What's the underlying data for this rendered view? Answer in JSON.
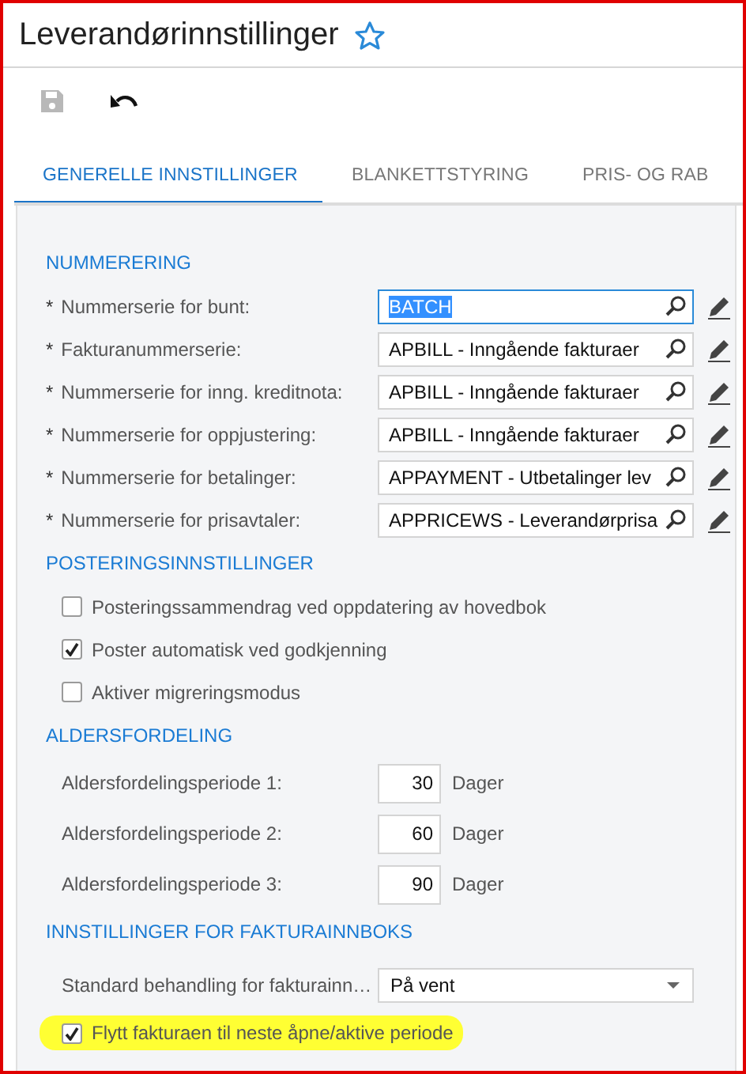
{
  "window": {
    "title": "Leverandørinnstillinger",
    "favorite": false
  },
  "toolbar": [
    {
      "kind": "save",
      "disabled": true
    },
    {
      "kind": "undo",
      "disabled": false
    }
  ],
  "tabs": [
    {
      "label": "GENERELLE INNSTILLINGER",
      "selected": true
    },
    {
      "label": "BLANKETTSTYRING",
      "selected": false
    },
    {
      "label": "PRIS- OG RAB",
      "selected": false
    }
  ],
  "sections": [
    {
      "title": "NUMMERERING",
      "rows": [
        {
          "kind": "lookup",
          "mark": "*",
          "label": "Nummerserie for bunt:",
          "value": "BATCH",
          "focused": true
        },
        {
          "kind": "lookup",
          "mark": "*",
          "label": "Fakturanummerserie:",
          "value": "APBILL - Inngående fakturaer",
          "focused": false
        },
        {
          "kind": "lookup",
          "mark": "*",
          "label": "Nummerserie for inng. kreditnota:",
          "value": "APBILL - Inngående fakturaer",
          "focused": false
        },
        {
          "kind": "lookup",
          "mark": "*",
          "label": "Nummerserie for oppjustering:",
          "value": "APBILL - Inngående fakturaer",
          "focused": false
        },
        {
          "kind": "lookup",
          "mark": "*",
          "label": "Nummerserie for betalinger:",
          "value": "APPAYMENT - Utbetalinger lev",
          "focused": false
        },
        {
          "kind": "lookup",
          "mark": "*",
          "label": "Nummerserie for prisavtaler:",
          "value": "APPRICEWS - Leverandørprisa",
          "focused": false
        }
      ]
    },
    {
      "title": "POSTERINGSINNSTILLINGER",
      "rows": [
        {
          "kind": "checkbox",
          "label": "Posteringssammendrag ved oppdatering av hovedbok",
          "checked": false,
          "highlighted": false
        },
        {
          "kind": "checkbox",
          "label": "Poster automatisk ved godkjenning",
          "checked": true,
          "highlighted": false
        },
        {
          "kind": "checkbox",
          "label": "Aktiver migreringsmodus",
          "checked": false,
          "highlighted": false
        }
      ]
    },
    {
      "title": "ALDERSFORDELING",
      "rows": [
        {
          "kind": "number",
          "label": "Aldersfordelingsperiode 1:",
          "value": "30",
          "unit": "Dager"
        },
        {
          "kind": "number",
          "label": "Aldersfordelingsperiode 2:",
          "value": "60",
          "unit": "Dager"
        },
        {
          "kind": "number",
          "label": "Aldersfordelingsperiode 3:",
          "value": "90",
          "unit": "Dager"
        }
      ]
    },
    {
      "title": "INNSTILLINGER FOR FAKTURAINNBOKS",
      "rows": [
        {
          "kind": "select",
          "label": "Standard behandling for fakturainn…",
          "value": "På vent"
        },
        {
          "kind": "checkbox",
          "label": "Flytt fakturaen til neste åpne/aktive periode",
          "checked": true,
          "highlighted": true
        }
      ]
    }
  ]
}
